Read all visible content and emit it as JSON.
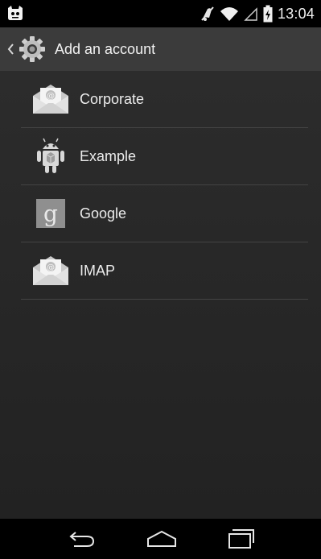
{
  "status_bar": {
    "time": "13:04",
    "left_icon": "notification-icon",
    "right_icons": [
      "mute-icon",
      "wifi-icon",
      "signal-icon",
      "battery-icon"
    ]
  },
  "action_bar": {
    "title": "Add an account",
    "icon": "settings-gear-icon"
  },
  "accounts": [
    {
      "label": "Corporate",
      "icon": "email-envelope-icon"
    },
    {
      "label": "Example",
      "icon": "android-robot-icon"
    },
    {
      "label": "Google",
      "icon": "google-g-icon"
    },
    {
      "label": "IMAP",
      "icon": "email-envelope-icon"
    }
  ],
  "nav_bar": {
    "buttons": [
      "back-icon",
      "home-icon",
      "recents-icon"
    ]
  },
  "colors": {
    "status_bar_bg": "#000000",
    "action_bar_bg": "#3b3b3b",
    "content_bg": "#2a2a2a",
    "divider": "#444444",
    "text": "#ececec"
  }
}
